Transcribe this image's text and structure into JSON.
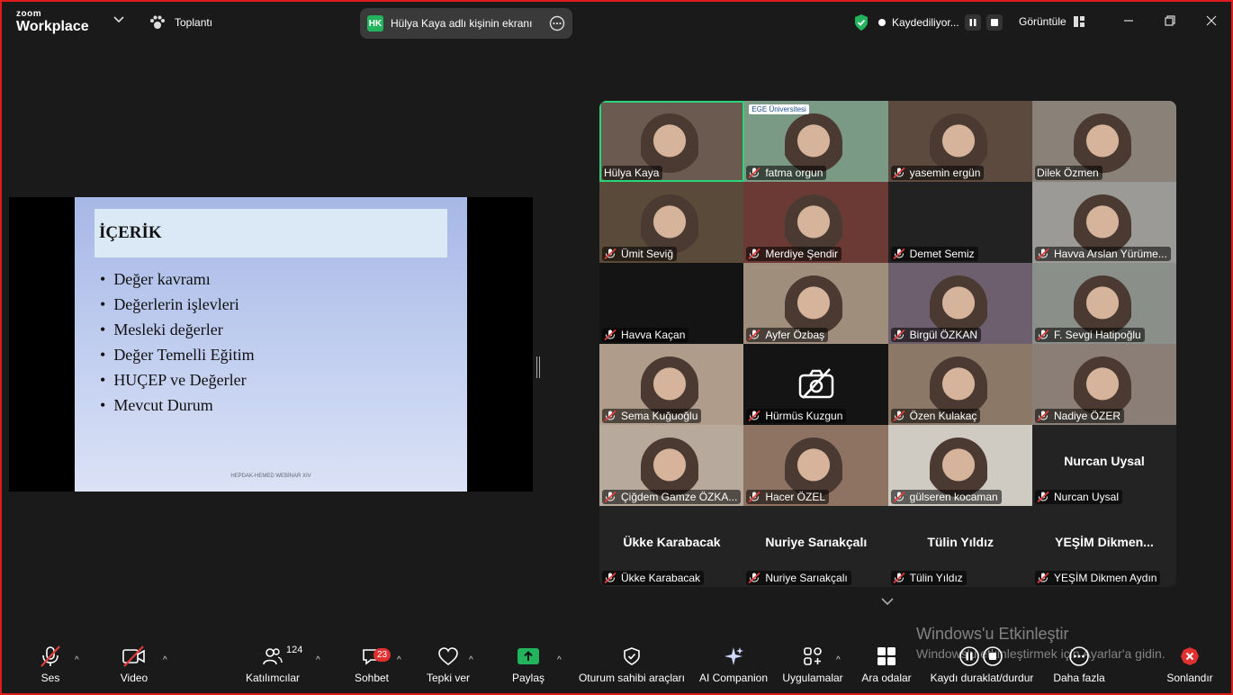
{
  "app": {
    "brand_top": "zoom",
    "brand_bottom": "Workplace"
  },
  "topbar": {
    "meeting_label": "Toplantı",
    "share_initials": "HK",
    "share_title": "Hülya Kaya adlı kişinin ekranı",
    "recording_label": "Kaydediliyor...",
    "view_label": "Görüntüle"
  },
  "slide": {
    "title": "İÇERİK",
    "items": [
      "Değer kavramı",
      "Değerlerin işlevleri",
      "Mesleki değerler",
      "Değer Temelli Eğitim",
      "HUÇEP ve Değerler",
      "Mevcut Durum"
    ],
    "footer": "HEPDAK-HEMED WEBİNAR XIV"
  },
  "gallery": {
    "participants": [
      {
        "name": "Hülya Kaya",
        "muted": false,
        "active": true,
        "video": true,
        "bg": "#6b5a4f"
      },
      {
        "name": "fatma orgun",
        "muted": true,
        "video": true,
        "bg": "#7a9a86",
        "overlay_text": "EGE Üniversitesi"
      },
      {
        "name": "yasemin ergün",
        "muted": true,
        "video": true,
        "bg": "#5c4a3e"
      },
      {
        "name": "Dilek Özmen",
        "muted": false,
        "video": true,
        "bg": "#8a8278"
      },
      {
        "name": "Ümit Seviğ",
        "muted": true,
        "video": true,
        "bg": "#5a4a3a"
      },
      {
        "name": "Merdiye Şendir",
        "muted": true,
        "video": true,
        "bg": "#6b3a35"
      },
      {
        "name": "Demet Semiz",
        "muted": true,
        "video": false,
        "bg": "#222222"
      },
      {
        "name": "Havva Arslan Yürüme...",
        "muted": true,
        "video": true,
        "bg": "#9c9a96"
      },
      {
        "name": "Havva Kaçan",
        "muted": true,
        "video": false,
        "bg": "#141414"
      },
      {
        "name": "Ayfer Özbaş",
        "muted": true,
        "video": true,
        "bg": "#a08e7c"
      },
      {
        "name": "Birgül ÖZKAN",
        "muted": true,
        "video": true,
        "bg": "#6e5f6e"
      },
      {
        "name": "F. Sevgi Hatipoğlu",
        "muted": true,
        "video": true,
        "bg": "#8b8f8a"
      },
      {
        "name": "Sema Kuğuoğlu",
        "muted": true,
        "video": true,
        "bg": "#b09c8a"
      },
      {
        "name": "Hürmüs Kuzgun",
        "muted": true,
        "video": false,
        "camera_off": true,
        "bg": "#141414"
      },
      {
        "name": "Özen Kulakaç",
        "muted": true,
        "video": true,
        "bg": "#8c7866"
      },
      {
        "name": "Nadiye ÖZER",
        "muted": true,
        "video": true,
        "bg": "#8a7e76"
      },
      {
        "name": "Çiğdem Gamze ÖZKA...",
        "muted": true,
        "video": true,
        "bg": "#b7a99b"
      },
      {
        "name": "Hacer ÖZEL",
        "muted": true,
        "video": true,
        "bg": "#8e7262"
      },
      {
        "name": "gülseren kocaman",
        "muted": true,
        "video": true,
        "bg": "#cfcac2"
      },
      {
        "name": "Nurcan Uysal",
        "muted": true,
        "video": false,
        "display_name": "Nurcan Uysal",
        "bg": "#232323"
      },
      {
        "name": "Ükke Karabacak",
        "muted": true,
        "video": false,
        "display_name": "Ükke Karabacak",
        "bg": "#232323"
      },
      {
        "name": "Nuriye Sarıakçalı",
        "muted": true,
        "video": false,
        "display_name": "Nuriye Sarıakçalı",
        "bg": "#232323"
      },
      {
        "name": "Tülin Yıldız",
        "muted": true,
        "video": false,
        "display_name": "Tülin Yıldız",
        "bg": "#232323"
      },
      {
        "name": "YEŞİM Dikmen Aydın",
        "muted": true,
        "video": false,
        "display_name": "YEŞİM  Dikmen...",
        "bg": "#232323"
      }
    ]
  },
  "watermark": {
    "line1": "Windows'u Etkinleştir",
    "line2": "Windows'u etkinleştirmek için Ayarlar'a gidin."
  },
  "toolbar": {
    "audio": "Ses",
    "video": "Video",
    "participants": "Katılımcılar",
    "participants_count": "124",
    "chat": "Sohbet",
    "chat_badge": "23",
    "reactions": "Tepki ver",
    "share": "Paylaş",
    "host_tools": "Oturum sahibi araçları",
    "ai": "AI Companion",
    "apps": "Uygulamalar",
    "breakout": "Ara odalar",
    "recording": "Kaydı duraklat/durdur",
    "more": "Daha fazla",
    "end": "Sonlandır"
  },
  "colors": {
    "accent_green": "#2ed47a",
    "share_green": "#23b35d",
    "end_red": "#e0302f",
    "mute_red": "#e03b3b",
    "frame_red": "#e01b1b"
  }
}
